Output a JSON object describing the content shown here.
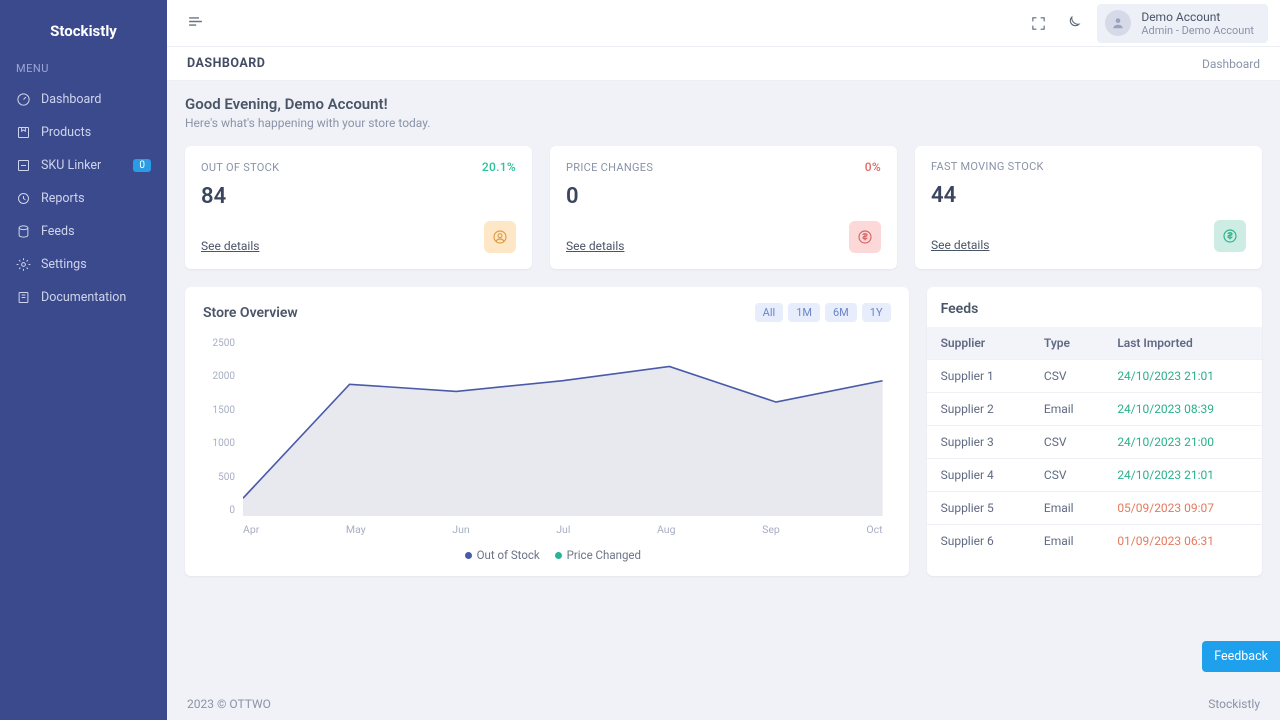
{
  "brand": "Stockistly",
  "sidebar": {
    "menu_label": "MENU",
    "items": [
      {
        "label": "Dashboard"
      },
      {
        "label": "Products"
      },
      {
        "label": "SKU Linker",
        "pill": "0"
      },
      {
        "label": "Reports"
      },
      {
        "label": "Feeds"
      },
      {
        "label": "Settings"
      },
      {
        "label": "Documentation"
      }
    ]
  },
  "account": {
    "name": "Demo Account",
    "role": "Admin - Demo Account"
  },
  "page": {
    "title": "DASHBOARD",
    "breadcrumb": "Dashboard"
  },
  "greeting": {
    "headline": "Good Evening, Demo Account!",
    "sub": "Here's what's happening with your store today."
  },
  "cards": {
    "out_of_stock": {
      "title": "OUT OF STOCK",
      "pct": "20.1%",
      "value": "84",
      "link": "See details",
      "badge_color": "orange"
    },
    "price_changes": {
      "title": "PRICE CHANGES",
      "pct": "0%",
      "value": "0",
      "link": "See details",
      "badge_color": "red"
    },
    "fast_moving": {
      "title": "FAST MOVING STOCK",
      "pct": "",
      "value": "44",
      "link": "See details",
      "badge_color": "teal"
    }
  },
  "chart": {
    "title": "Store Overview",
    "ranges": [
      "All",
      "1M",
      "6M",
      "1Y"
    ],
    "legend": {
      "a": "Out of Stock",
      "b": "Price Changed"
    }
  },
  "chart_data": {
    "type": "line",
    "categories": [
      "Apr",
      "May",
      "Jun",
      "Jul",
      "Aug",
      "Sep",
      "Oct"
    ],
    "series": [
      {
        "name": "Out of Stock",
        "values": [
          250,
          1850,
          1750,
          1900,
          2100,
          1600,
          1900
        ]
      },
      {
        "name": "Price Changed",
        "values": [
          0,
          0,
          0,
          0,
          0,
          0,
          0
        ]
      }
    ],
    "ylim": [
      0,
      2500
    ],
    "y_ticks": [
      2500,
      2000,
      1500,
      1000,
      500,
      0
    ],
    "xlabel": "",
    "ylabel": ""
  },
  "feeds": {
    "title": "Feeds",
    "columns": [
      "Supplier",
      "Type",
      "Last Imported"
    ],
    "rows": [
      {
        "supplier": "Supplier 1",
        "type": "CSV",
        "date": "24/10/2023 21:01",
        "status": "ok"
      },
      {
        "supplier": "Supplier 2",
        "type": "Email",
        "date": "24/10/2023 08:39",
        "status": "ok"
      },
      {
        "supplier": "Supplier 3",
        "type": "CSV",
        "date": "24/10/2023 21:00",
        "status": "ok"
      },
      {
        "supplier": "Supplier 4",
        "type": "CSV",
        "date": "24/10/2023 21:01",
        "status": "ok"
      },
      {
        "supplier": "Supplier 5",
        "type": "Email",
        "date": "05/09/2023 09:07",
        "status": "stale"
      },
      {
        "supplier": "Supplier 6",
        "type": "Email",
        "date": "01/09/2023 06:31",
        "status": "stale"
      }
    ]
  },
  "footer": {
    "left": "2023 © OTTWO",
    "right": "Stockistly"
  },
  "feedback": "Feedback"
}
